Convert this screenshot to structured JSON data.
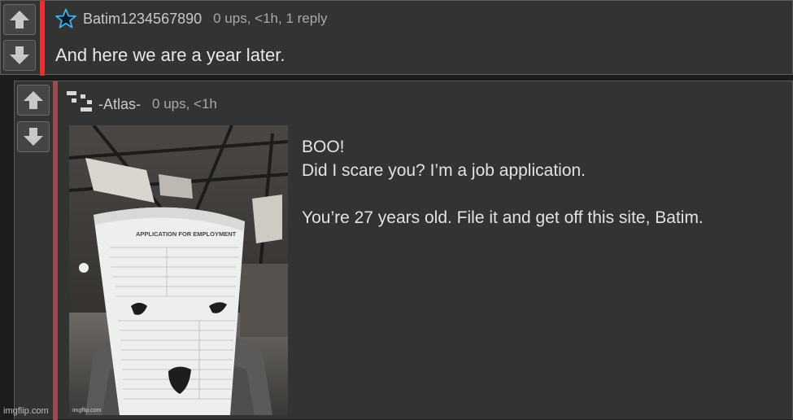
{
  "comment": {
    "username": "Batim1234567890",
    "stats": "0 ups, <1h, 1 reply",
    "body": "And here we are a year later.",
    "accent_color": "#ea2f2f"
  },
  "reply": {
    "username": "-Atlas-",
    "stats": "0 ups, <1h",
    "lines": [
      "BOO!",
      "Did I scare you? I’m a job application.",
      "",
      "You’re 27 years old. File it and get off this site, Batim."
    ],
    "image": {
      "form_title": "APPLICATION FOR EMPLOYMENT",
      "watermark": "imgflip.com"
    },
    "accent_color": "#9a4b4b"
  },
  "page": {
    "watermark": "imgflip.com"
  },
  "icons": {
    "upvote": "up-arrow-icon",
    "downvote": "down-arrow-icon",
    "star": "star-icon",
    "avatar": "pixel-avatar-icon"
  }
}
